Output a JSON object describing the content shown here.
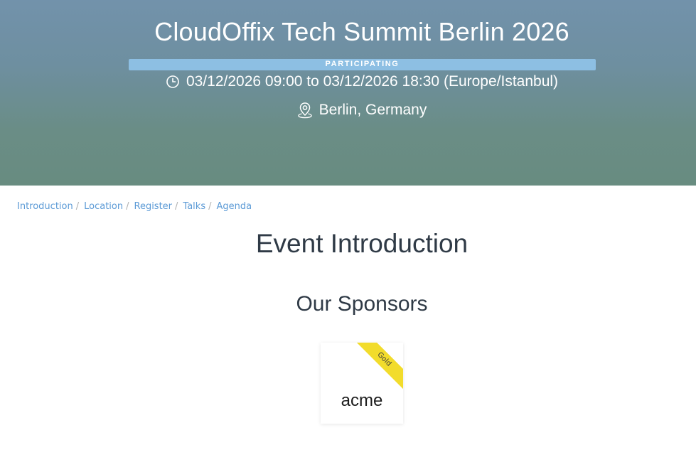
{
  "event": {
    "title": "CloudOffix Tech Summit Berlin 2026",
    "status": "PARTICIPATING",
    "date_range": "03/12/2026 09:00 to 03/12/2026 18:30 (Europe/Istanbul)",
    "location": "Berlin, Germany"
  },
  "breadcrumb": [
    {
      "label": "Introduction"
    },
    {
      "label": "Location"
    },
    {
      "label": "Register"
    },
    {
      "label": "Talks"
    },
    {
      "label": "Agenda"
    }
  ],
  "breadcrumb_separator": "/",
  "main": {
    "section_title": "Event Introduction",
    "sponsors_title": "Our Sponsors"
  },
  "sponsors": [
    {
      "name": "acme",
      "level": "Gold"
    }
  ],
  "colors": {
    "hero_top": "#7292ab",
    "hero_bottom": "#688c80",
    "status_bar": "#8dbfe3",
    "link": "#5b9ad6",
    "ribbon": "#f2dc2c"
  },
  "icons": {
    "date": "clock-icon",
    "location": "map-pin-icon"
  }
}
